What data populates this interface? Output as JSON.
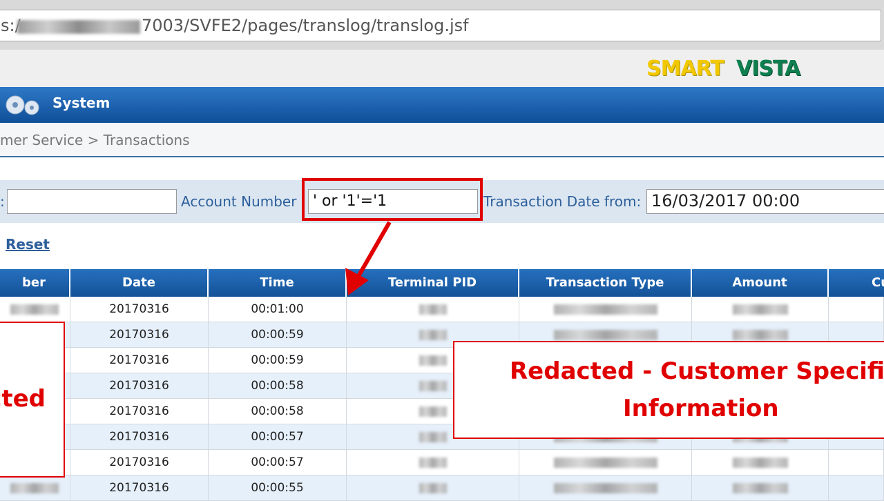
{
  "browser": {
    "url_prefix": "s:/",
    "url_path": "7003/SVFE2/pages/translog/translog.jsf"
  },
  "header": {
    "logo_part1": "SMART",
    "logo_part2": "VISTA",
    "brand_colors": {
      "smart": "#f2c800",
      "vista": "#0f7f4f"
    }
  },
  "nav": {
    "system_label": "System"
  },
  "breadcrumb": "mer Service > Transactions",
  "filters": {
    "first_label": ":",
    "first_value": "",
    "account_label": "Account Number",
    "account_value": "' or '1'='1",
    "date_from_label": "Transaction Date from:",
    "date_from_value": "16/03/2017 00:00"
  },
  "actions": {
    "reset_label": "Reset"
  },
  "table": {
    "columns": [
      "ber",
      "Date",
      "Time",
      "Terminal PID",
      "Transaction Type",
      "Amount",
      "Cu"
    ],
    "rows": [
      {
        "date": "20170316",
        "time": "00:01:00"
      },
      {
        "date": "20170316",
        "time": "00:00:59"
      },
      {
        "date": "20170316",
        "time": "00:00:59"
      },
      {
        "date": "20170316",
        "time": "00:00:58"
      },
      {
        "date": "20170316",
        "time": "00:00:58"
      },
      {
        "date": "20170316",
        "time": "00:00:57"
      },
      {
        "date": "20170316",
        "time": "00:00:57"
      },
      {
        "date": "20170316",
        "time": "00:00:55"
      }
    ]
  },
  "annotations": {
    "left_text": "cted",
    "right_line1": "Redacted - Customer Specific",
    "right_line2": "Information",
    "highlight_color": "#e00000"
  }
}
